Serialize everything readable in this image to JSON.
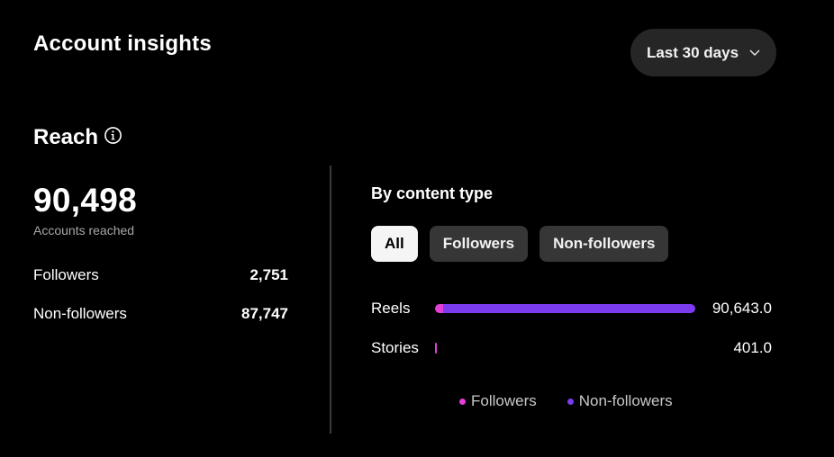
{
  "header": {
    "title": "Account insights",
    "range_label": "Last 30 days"
  },
  "reach": {
    "title": "Reach",
    "total": "90,498",
    "total_label": "Accounts reached",
    "rows": [
      {
        "label": "Followers",
        "value": "2,751"
      },
      {
        "label": "Non-followers",
        "value": "87,747"
      }
    ]
  },
  "content_type": {
    "title": "By content type",
    "filters": [
      "All",
      "Followers",
      "Non-followers"
    ],
    "active_filter": "All",
    "bars": [
      {
        "label": "Reels",
        "value": "90,643.0",
        "followers": 2.7,
        "non_followers": 87.9,
        "max": 90.6
      },
      {
        "label": "Stories",
        "value": "401.0",
        "followers": 0.4,
        "non_followers": 0.0,
        "max": 90.6
      }
    ],
    "legend": [
      {
        "label": "Followers",
        "color": "#e23ed8"
      },
      {
        "label": "Non-followers",
        "color": "#7b3cf0"
      }
    ]
  },
  "colors": {
    "followers": "#e23ed8",
    "non_followers": "#7b3cf0",
    "chip_bg": "#363636",
    "chip_active_bg": "#f5f5f5"
  },
  "icons": {
    "info": "info-circle-icon",
    "dropdown": "chevron-down-icon"
  }
}
